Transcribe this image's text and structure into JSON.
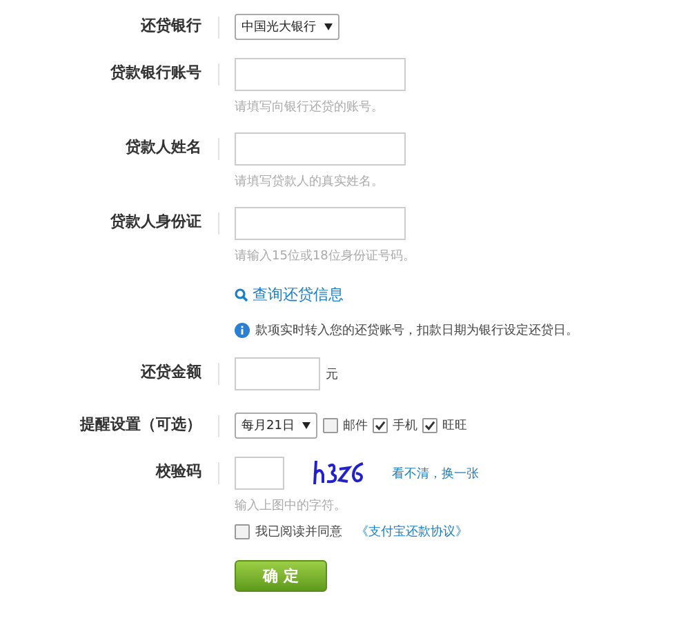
{
  "bank": {
    "label": "还贷银行",
    "value": "中国光大银行"
  },
  "inputs": [
    {
      "label": "贷款银行账号",
      "hint": "请填写向银行还贷的账号。"
    },
    {
      "label": "贷款人姓名",
      "hint": "请填写贷款人的真实姓名。"
    },
    {
      "label": "贷款人身份证",
      "hint": "请输入15位或18位身份证号码。"
    }
  ],
  "query_link": "查询还贷信息",
  "notice": "款项实时转入您的还贷账号，扣款日期为银行设定还贷日。",
  "amount": {
    "label": "还贷金额",
    "unit": "元"
  },
  "reminder": {
    "label": "提醒设置（可选）",
    "day": "每月21日",
    "options": [
      {
        "label": "邮件",
        "checked": false
      },
      {
        "label": "手机",
        "checked": true
      },
      {
        "label": "旺旺",
        "checked": true
      }
    ]
  },
  "captcha": {
    "label": "校验码",
    "hint": "输入上图中的字符。",
    "refresh": "看不清，换一张"
  },
  "agreement": {
    "checked": false,
    "text": "我已阅读并同意",
    "link": "《支付宝还款协议》"
  },
  "submit": "确 定"
}
